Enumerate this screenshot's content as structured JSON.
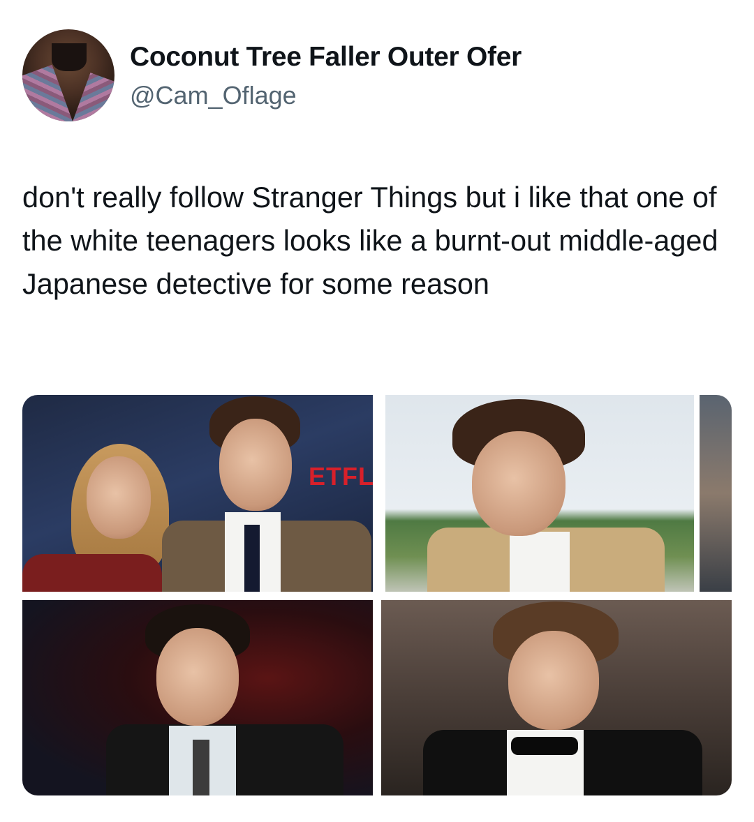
{
  "tweet": {
    "display_name": "Coconut Tree Faller Outer Ofer",
    "handle": "@Cam_Oflage",
    "text": "don't really follow Stranger Things but i like that one of the white teenagers looks like a burnt-out middle-aged Japanese detective for some reason",
    "avatar_icon": "profile-avatar",
    "media_sign_text": "ETFLIX"
  },
  "colors": {
    "name": "#0f1419",
    "handle": "#536471",
    "netflix_red": "#d8202a"
  }
}
